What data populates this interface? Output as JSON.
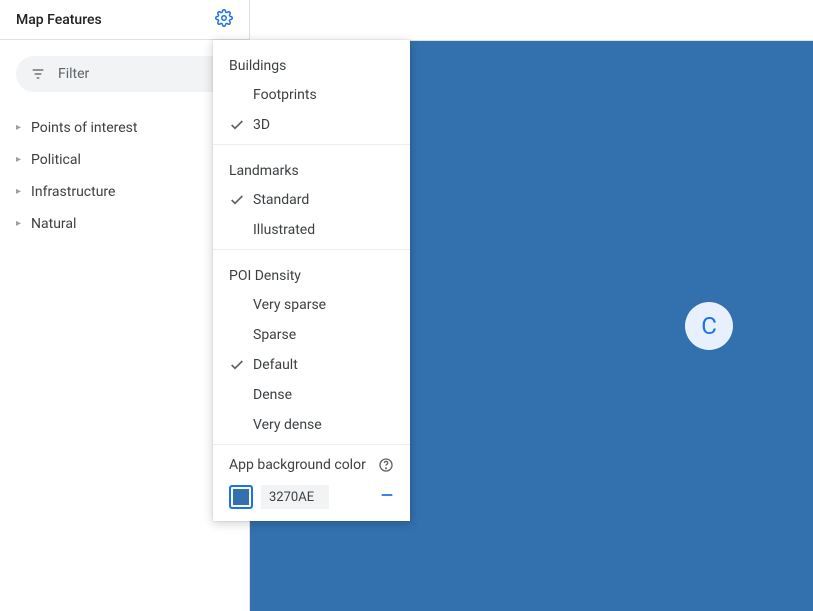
{
  "sidebar": {
    "title": "Map Features",
    "filter_label": "Filter",
    "items": [
      {
        "label": "Points of interest"
      },
      {
        "label": "Political"
      },
      {
        "label": "Infrastructure"
      },
      {
        "label": "Natural"
      }
    ]
  },
  "settings_popup": {
    "sections": [
      {
        "title": "Buildings",
        "options": [
          {
            "label": "Footprints",
            "selected": false
          },
          {
            "label": "3D",
            "selected": true
          }
        ]
      },
      {
        "title": "Landmarks",
        "options": [
          {
            "label": "Standard",
            "selected": true
          },
          {
            "label": "Illustrated",
            "selected": false
          }
        ]
      },
      {
        "title": "POI Density",
        "options": [
          {
            "label": "Very sparse",
            "selected": false
          },
          {
            "label": "Sparse",
            "selected": false
          },
          {
            "label": "Default",
            "selected": true
          },
          {
            "label": "Dense",
            "selected": false
          },
          {
            "label": "Very dense",
            "selected": false
          }
        ]
      }
    ],
    "bg_color": {
      "label": "App background color",
      "hex": "3270AE",
      "color": "#3270AE"
    }
  },
  "canvas": {
    "bg": "#3270AE",
    "avatar_letter": "C"
  }
}
